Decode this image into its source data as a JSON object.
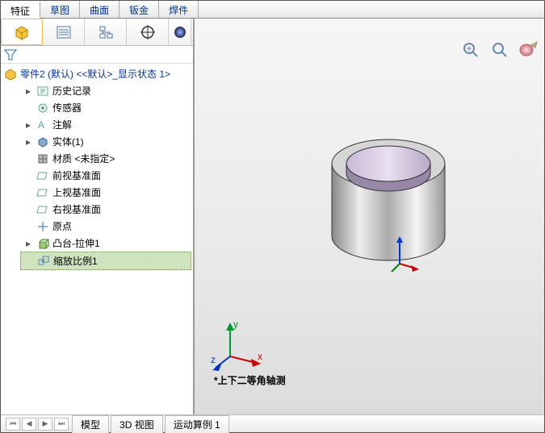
{
  "tabs_top": [
    {
      "label": "特征",
      "active": true
    },
    {
      "label": "草图",
      "active": false
    },
    {
      "label": "曲面",
      "active": false
    },
    {
      "label": "钣金",
      "active": false
    },
    {
      "label": "焊件",
      "active": false
    }
  ],
  "tree": {
    "root_label": "零件2 (默认) <<默认>_显示状态 1>",
    "items": [
      {
        "label": "历史记录",
        "icon": "history-icon",
        "expander": "▸"
      },
      {
        "label": "传感器",
        "icon": "sensor-icon",
        "expander": ""
      },
      {
        "label": "注解",
        "icon": "annotation-icon",
        "expander": "▸"
      },
      {
        "label": "实体(1)",
        "icon": "solid-icon",
        "expander": "▸"
      },
      {
        "label": "材质 <未指定>",
        "icon": "material-icon",
        "expander": ""
      },
      {
        "label": "前视基准面",
        "icon": "plane-icon",
        "expander": ""
      },
      {
        "label": "上视基准面",
        "icon": "plane-icon",
        "expander": ""
      },
      {
        "label": "右视基准面",
        "icon": "plane-icon",
        "expander": ""
      },
      {
        "label": "原点",
        "icon": "origin-icon",
        "expander": ""
      },
      {
        "label": "凸台-拉伸1",
        "icon": "extrude-icon",
        "expander": "▸"
      },
      {
        "label": "缩放比例1",
        "icon": "scale-icon",
        "expander": "",
        "selected": true
      }
    ]
  },
  "view_label": "*上下二等角轴测",
  "axis_labels": {
    "x": "x",
    "y": "y",
    "z": "z"
  },
  "bottom_tabs": [
    {
      "label": "模型"
    },
    {
      "label": "3D 视图"
    },
    {
      "label": "运动算例 1"
    }
  ],
  "nav_buttons": [
    "⏮",
    "◀",
    "▶",
    "⏭"
  ]
}
